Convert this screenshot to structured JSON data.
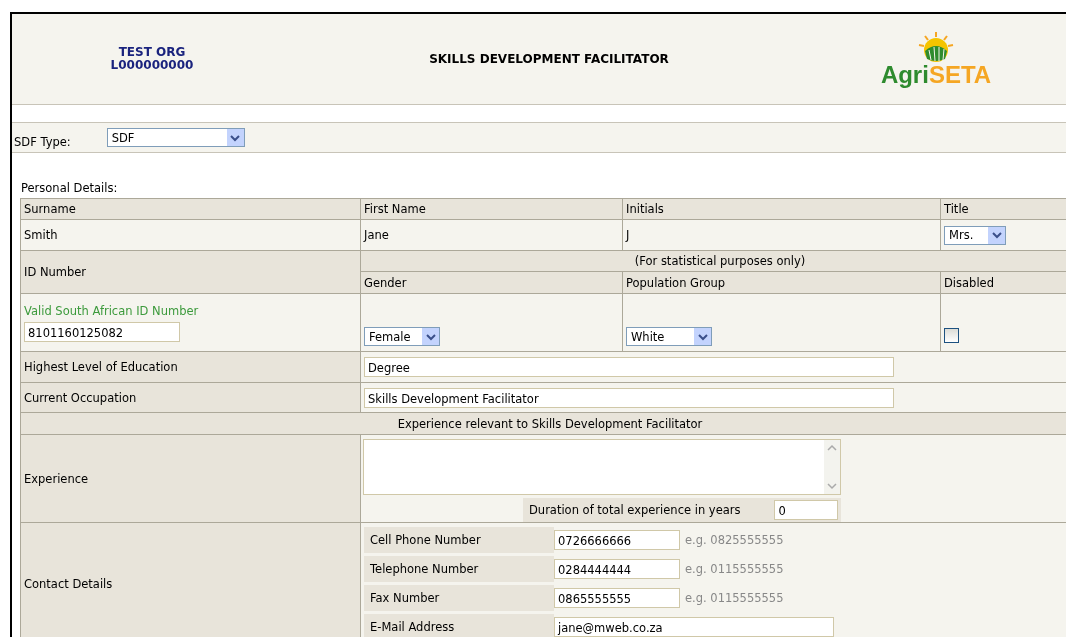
{
  "header": {
    "org_name": "TEST ORG",
    "org_code": "L000000000",
    "title": "SKILLS DEVELOPMENT FACILITATOR",
    "logo": {
      "part_1": "Agri",
      "part_2": "SETA"
    }
  },
  "sdf_type": {
    "label": "SDF Type:",
    "value": "SDF"
  },
  "personal_details": {
    "heading": "Personal Details:",
    "columns": [
      "Surname",
      "First Name",
      "Initials",
      "Title"
    ],
    "surname": "Smith",
    "first_name": "Jane",
    "initials": "J",
    "title": "Mrs.",
    "id_label": "ID Number",
    "statistical_note": "(For statistical purposes only)",
    "stat_columns": [
      "Gender",
      "Population Group",
      "Disabled"
    ],
    "id_hint": "Valid South African ID Number",
    "id_number": "8101160125082",
    "gender": "Female",
    "population_group": "White",
    "disabled": false,
    "education_label": "Highest Level of Education",
    "education": "Degree",
    "occupation_label": "Current Occupation",
    "occupation": "Skills Development Facilitator",
    "experience_heading": "Experience relevant to Skills Development Facilitator",
    "experience_label": "Experience",
    "duration_label": "Duration of total experience in years",
    "duration": "0",
    "contact_label": "Contact Details",
    "contacts": [
      {
        "label": "Cell Phone Number",
        "value": "0726666666",
        "example": "e.g. 0825555555"
      },
      {
        "label": "Telephone Number",
        "value": "0284444444",
        "example": "e.g. 0115555555"
      },
      {
        "label": "Fax Number",
        "value": "0865555555",
        "example": "e.g. 0115555555"
      }
    ],
    "email": {
      "label": "E-Mail Address",
      "value": "jane@mweb.co.za"
    }
  }
}
